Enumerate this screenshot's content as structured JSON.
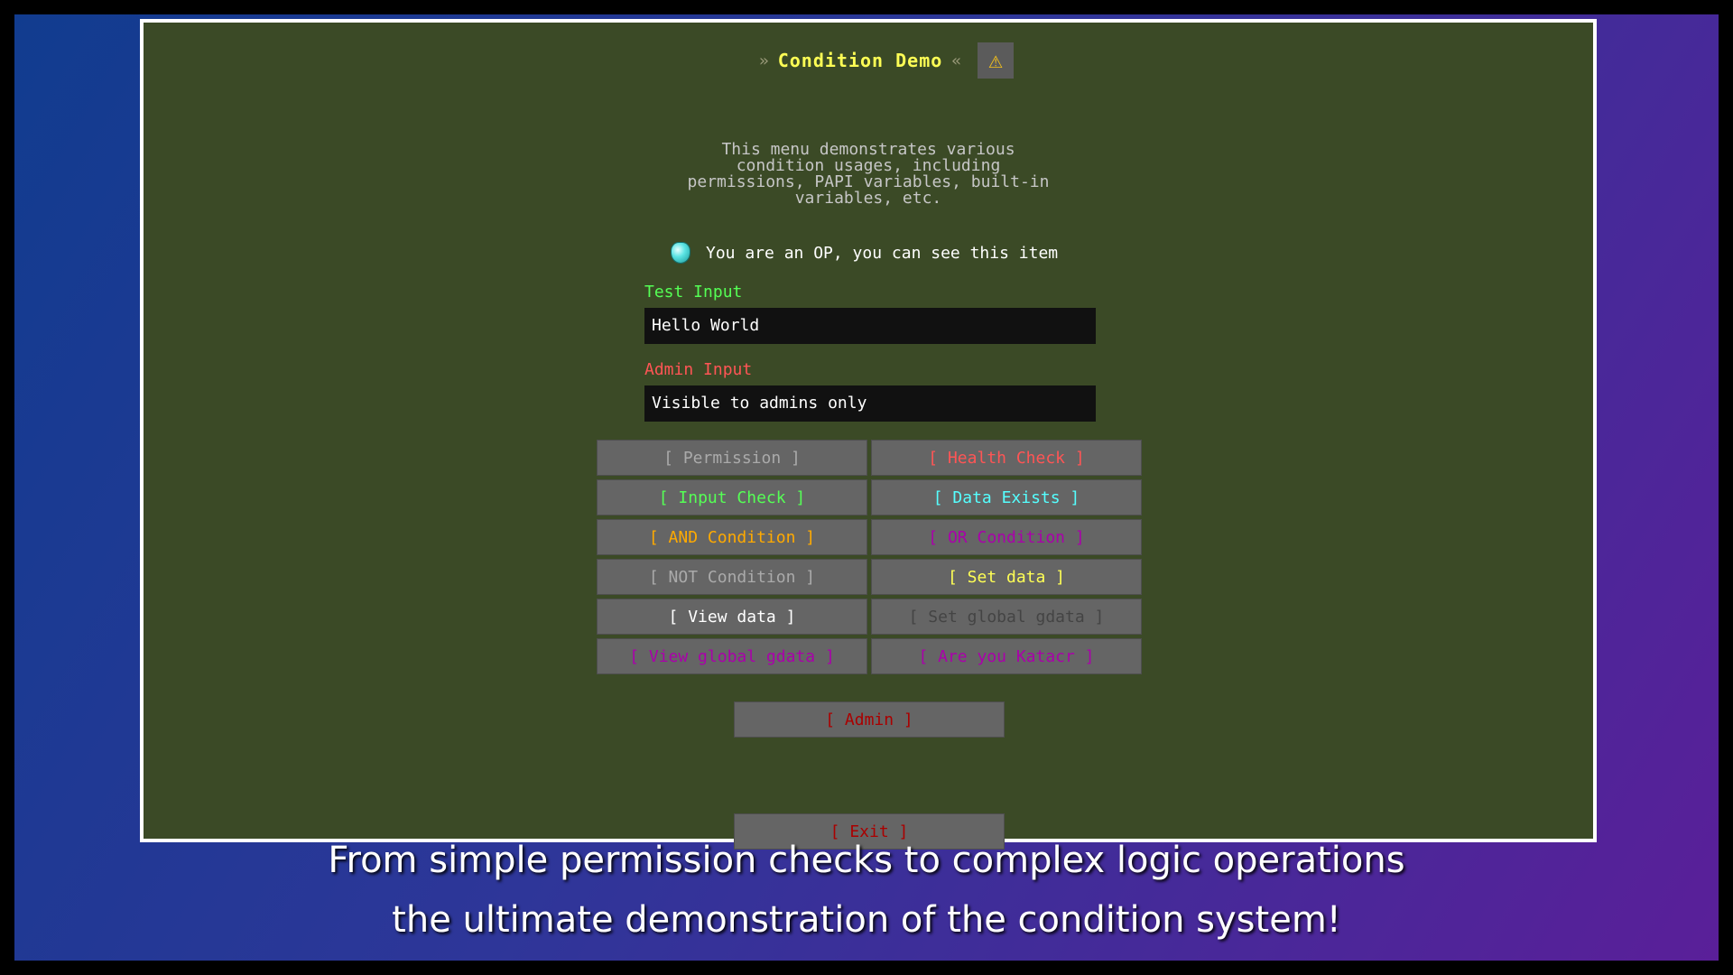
{
  "menu": {
    "title_prefix": "»",
    "title": "Condition Demo",
    "title_suffix": "«",
    "warning_icon": "warning-icon",
    "description_lines": [
      "This menu demonstrates various",
      "condition usages, including",
      "permissions, PAPI variables, built-in",
      "variables, etc."
    ],
    "op_item": {
      "icon": "diamond-icon",
      "text": "You are an OP, you can see this item"
    },
    "test_input": {
      "label": "Test Input",
      "value": "Hello World",
      "label_color": "#55ff55"
    },
    "admin_input": {
      "label": "Admin Input",
      "value": "Visible to admins only",
      "label_color": "#ff5555"
    },
    "buttons": [
      {
        "label": "[ Permission ]",
        "color": "#aaaaaa"
      },
      {
        "label": "[ Health Check ]",
        "color": "#ff5555"
      },
      {
        "label": "[ Input Check ]",
        "color": "#55ff55"
      },
      {
        "label": "[ Data Exists ]",
        "color": "#55ffff"
      },
      {
        "label": "[ AND Condition ]",
        "color": "#ffaa00"
      },
      {
        "label": "[ OR Condition ]",
        "color": "#aa00aa"
      },
      {
        "label": "[ NOT Condition ]",
        "color": "#aaaaaa"
      },
      {
        "label": "[ Set data ]",
        "color": "#ffff55"
      },
      {
        "label": "[ View data ]",
        "color": "#ffffff"
      },
      {
        "label": "[ Set global gdata ]",
        "color": "#444444"
      },
      {
        "label": "[ View global gdata ]",
        "color": "#aa00aa"
      },
      {
        "label": "[ Are you Katacr ]",
        "color": "#aa00aa"
      }
    ],
    "admin_button": {
      "label": "[ Admin ]",
      "color": "#aa0000"
    },
    "exit_button": {
      "label": "[ Exit ]",
      "color": "#aa0000"
    }
  },
  "caption": {
    "line1": "From simple permission checks to complex logic operations",
    "line2": "the ultimate demonstration of the condition system!"
  }
}
